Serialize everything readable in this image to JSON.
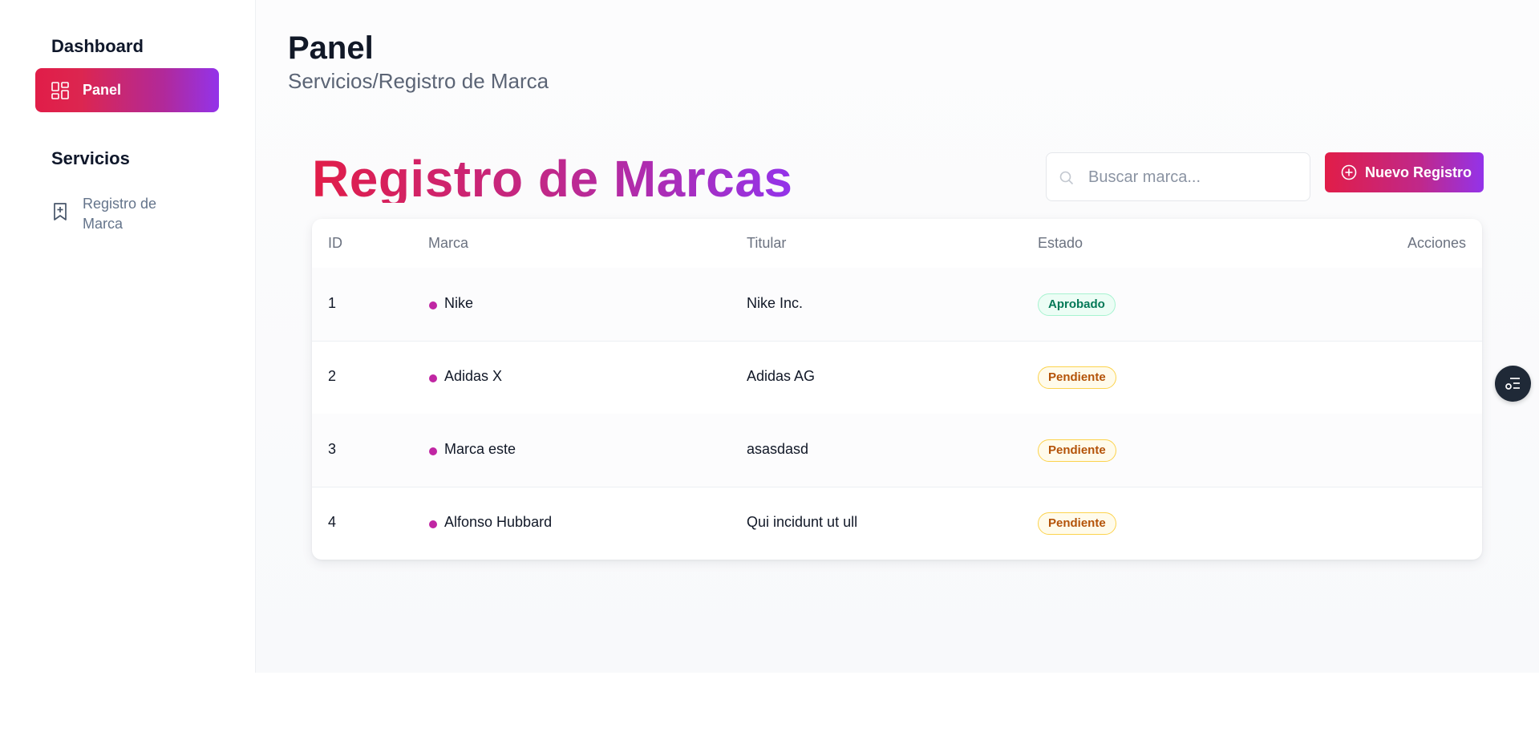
{
  "sidebar": {
    "sections": [
      {
        "heading": "Dashboard"
      },
      {
        "heading": "Servicios"
      }
    ],
    "items": [
      {
        "label": "Panel",
        "icon": "grid-icon",
        "active": true
      },
      {
        "label": "Registro de Marca",
        "icon": "bookmark-plus-icon",
        "active": false
      }
    ]
  },
  "header": {
    "title": "Panel",
    "breadcrumb": "Servicios/Registro de Marca"
  },
  "main": {
    "title": "Registro de Marcas",
    "search": {
      "placeholder": "Buscar marca...",
      "value": ""
    },
    "new_button": {
      "label": "Nuevo Registro",
      "icon": "plus-circle-icon"
    },
    "table": {
      "columns": [
        "ID",
        "Marca",
        "Titular",
        "Estado",
        "Acciones"
      ],
      "rows": [
        {
          "id": "1",
          "marca": "Nike",
          "titular": "Nike Inc.",
          "estado": "Aprobado"
        },
        {
          "id": "2",
          "marca": "Adidas X",
          "titular": "Adidas AG",
          "estado": "Pendiente"
        },
        {
          "id": "3",
          "marca": "Marca este",
          "titular": "asasdasd",
          "estado": "Pendiente"
        },
        {
          "id": "4",
          "marca": "Alfonso Hubbard",
          "titular": "Qui incidunt ut ull",
          "estado": "Pendiente"
        }
      ]
    }
  },
  "colors": {
    "accent_start": "#e11d48",
    "accent_end": "#9333ea",
    "status_approved": "#047857",
    "status_pending": "#b45309"
  },
  "floating_button": {
    "icon": "settings-list-icon"
  }
}
